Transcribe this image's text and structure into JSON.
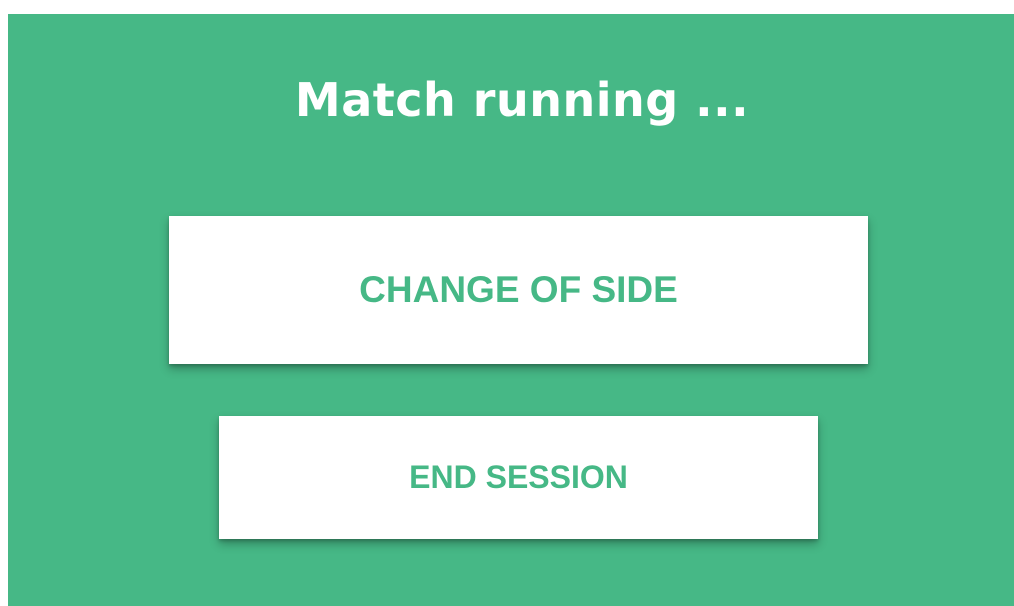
{
  "screen": {
    "title": "Match running ...",
    "background_color": "#46b886"
  },
  "actions": {
    "change_side_label": "CHANGE OF SIDE",
    "end_session_label": "END SESSION",
    "button_background": "#ffffff",
    "button_text_color": "#46b886"
  }
}
